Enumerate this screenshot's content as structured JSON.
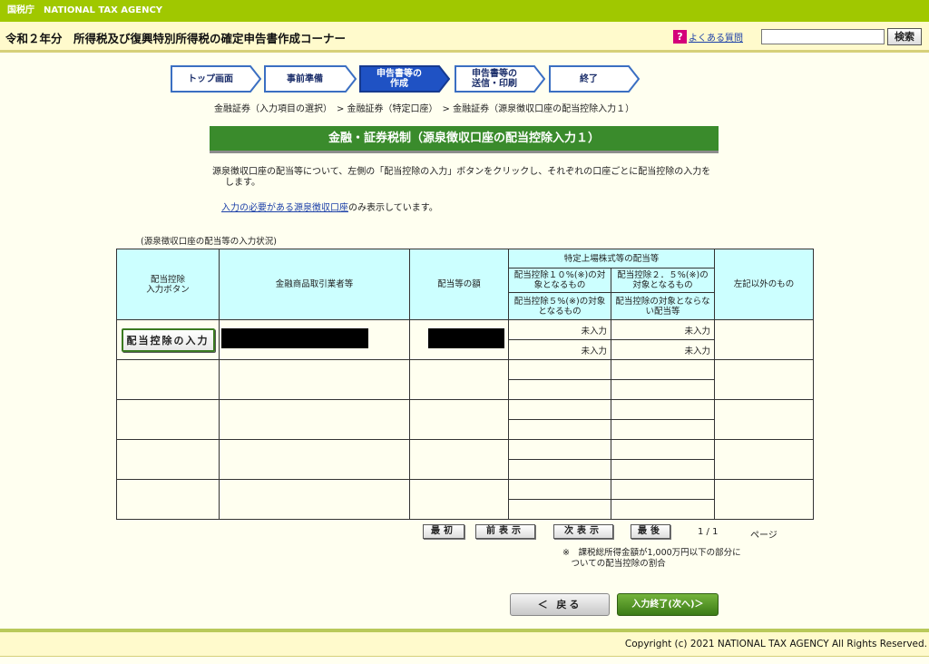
{
  "topbar": {
    "agency": "国税庁　NATIONAL TAX AGENCY"
  },
  "header": {
    "title": "令和２年分　所得税及び復興特別所得税の確定申告書作成コーナー",
    "faq_icon": "?",
    "faq_label": "よくある質問",
    "search_value": "",
    "search_button": "検索"
  },
  "steps": [
    {
      "label": "トップ画面",
      "active": false
    },
    {
      "label": "事前準備",
      "active": false
    },
    {
      "label": "申告書等の\n作成",
      "active": true
    },
    {
      "label": "申告書等の\n送信・印刷",
      "active": false
    },
    {
      "label": "終了",
      "active": false
    }
  ],
  "breadcrumb": "金融証券（入力項目の選択）　> 金融証券（特定口座）　> 金融証券（源泉徴収口座の配当控除入力１）",
  "section_title": "金融・証券税制（源泉徴収口座の配当控除入力１）",
  "description": "源泉徴収口座の配当等について、左側の「配当控除の入力」ボタンをクリックし、それぞれの口座ごとに配当控除の入力をします。",
  "note": {
    "link": "入力の必要がある源泉徴収口座",
    "suffix": "のみ表示しています。"
  },
  "table": {
    "caption": "(源泉徴収口座の配当等の入力状況)",
    "headers": {
      "button_col": "配当控除\n入力ボタン",
      "broker": "金融商品取引業者等",
      "amount": "配当等の額",
      "listed_group": "特定上場株式等の配当等",
      "c10": "配当控除１０%(※)の対象となるもの",
      "c25": "配当控除２．５%(※)の対象となるもの",
      "c5": "配当控除５%(※)の対象となるもの",
      "cnone": "配当控除の対象とならない配当等",
      "other": "左記以外のもの"
    },
    "deduct_button": "配当控除の入力",
    "row1": {
      "c10": "未入力",
      "c25": "未入力",
      "c5": "未入力",
      "cnone": "未入力"
    }
  },
  "pager": {
    "first": "最初",
    "prev": "前表示",
    "next": "次表示",
    "last": "最後",
    "page": "1 / 1",
    "page_label": "ページ"
  },
  "footnote": "※　課税総所得金額が1,000万円以下の部分に\n　ついての配当控除の割合",
  "buttons": {
    "back": "＜ 戻る",
    "next": "入力終了(次へ)＞"
  },
  "footer": {
    "copyright": "Copyright (c) 2021 NATIONAL TAX AGENCY All Rights Reserved."
  }
}
